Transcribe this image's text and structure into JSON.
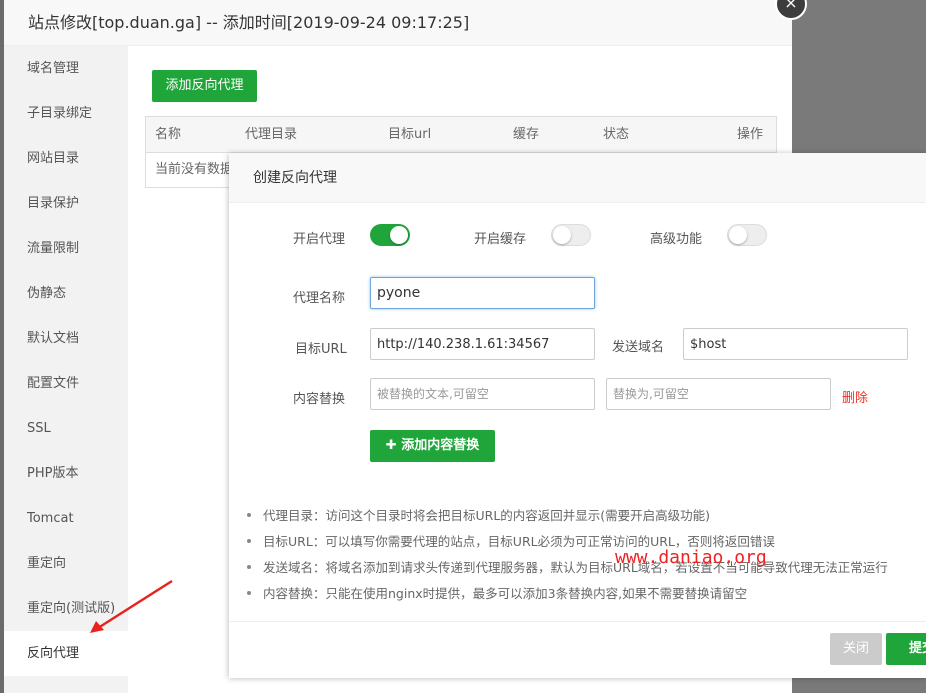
{
  "outer_window": {
    "title": "站点修改[top.duan.ga] -- 添加时间[2019-09-24 09:17:25]",
    "close_glyph": "×"
  },
  "sidebar": {
    "items": [
      {
        "label": "域名管理"
      },
      {
        "label": "子目录绑定"
      },
      {
        "label": "网站目录"
      },
      {
        "label": "目录保护"
      },
      {
        "label": "流量限制"
      },
      {
        "label": "伪静态"
      },
      {
        "label": "默认文档"
      },
      {
        "label": "配置文件"
      },
      {
        "label": "SSL"
      },
      {
        "label": "PHP版本"
      },
      {
        "label": "Tomcat"
      },
      {
        "label": "重定向"
      },
      {
        "label": "重定向(测试版)"
      },
      {
        "label": "反向代理"
      }
    ],
    "active": "反向代理"
  },
  "proxy_list": {
    "add_button": "添加反向代理",
    "columns": [
      "名称",
      "代理目录",
      "目标url",
      "缓存",
      "状态",
      "操作"
    ],
    "empty_text": "当前没有数据"
  },
  "modal": {
    "title": "创建反向代理",
    "toggles": {
      "enable_proxy": {
        "label": "开启代理",
        "on": true
      },
      "enable_cache": {
        "label": "开启缓存",
        "on": false
      },
      "advanced": {
        "label": "高级功能",
        "on": false
      }
    },
    "proxy_name": {
      "label": "代理名称",
      "value": "pyone"
    },
    "target_url": {
      "label": "目标URL",
      "value": "http://140.238.1.61:34567"
    },
    "send_domain": {
      "label": "发送域名",
      "value": "$host"
    },
    "content_replace": {
      "label": "内容替换",
      "from_placeholder": "被替换的文本,可留空",
      "to_placeholder": "替换为,可留空",
      "delete_label": "删除"
    },
    "add_replace_button": "✚ 添加内容替换",
    "notes": [
      "代理目录：访问这个目录时将会把目标URL的内容返回并显示(需要开启高级功能)",
      "目标URL：可以填写你需要代理的站点，目标URL必须为可正常访问的URL，否则将返回错误",
      "发送域名：将域名添加到请求头传递到代理服务器，默认为目标URL域名，若设置不当可能导致代理无法正常运行",
      "内容替换：只能在使用nginx时提供，最多可以添加3条替换内容,如果不需要替换请留空"
    ],
    "close_button": "关闭",
    "submit_button": "提交"
  },
  "watermark": "www.daniao.org",
  "colors": {
    "accent_green": "#20a53a",
    "delete_red": "#ee3322",
    "overlay": "#6b6b6b"
  }
}
